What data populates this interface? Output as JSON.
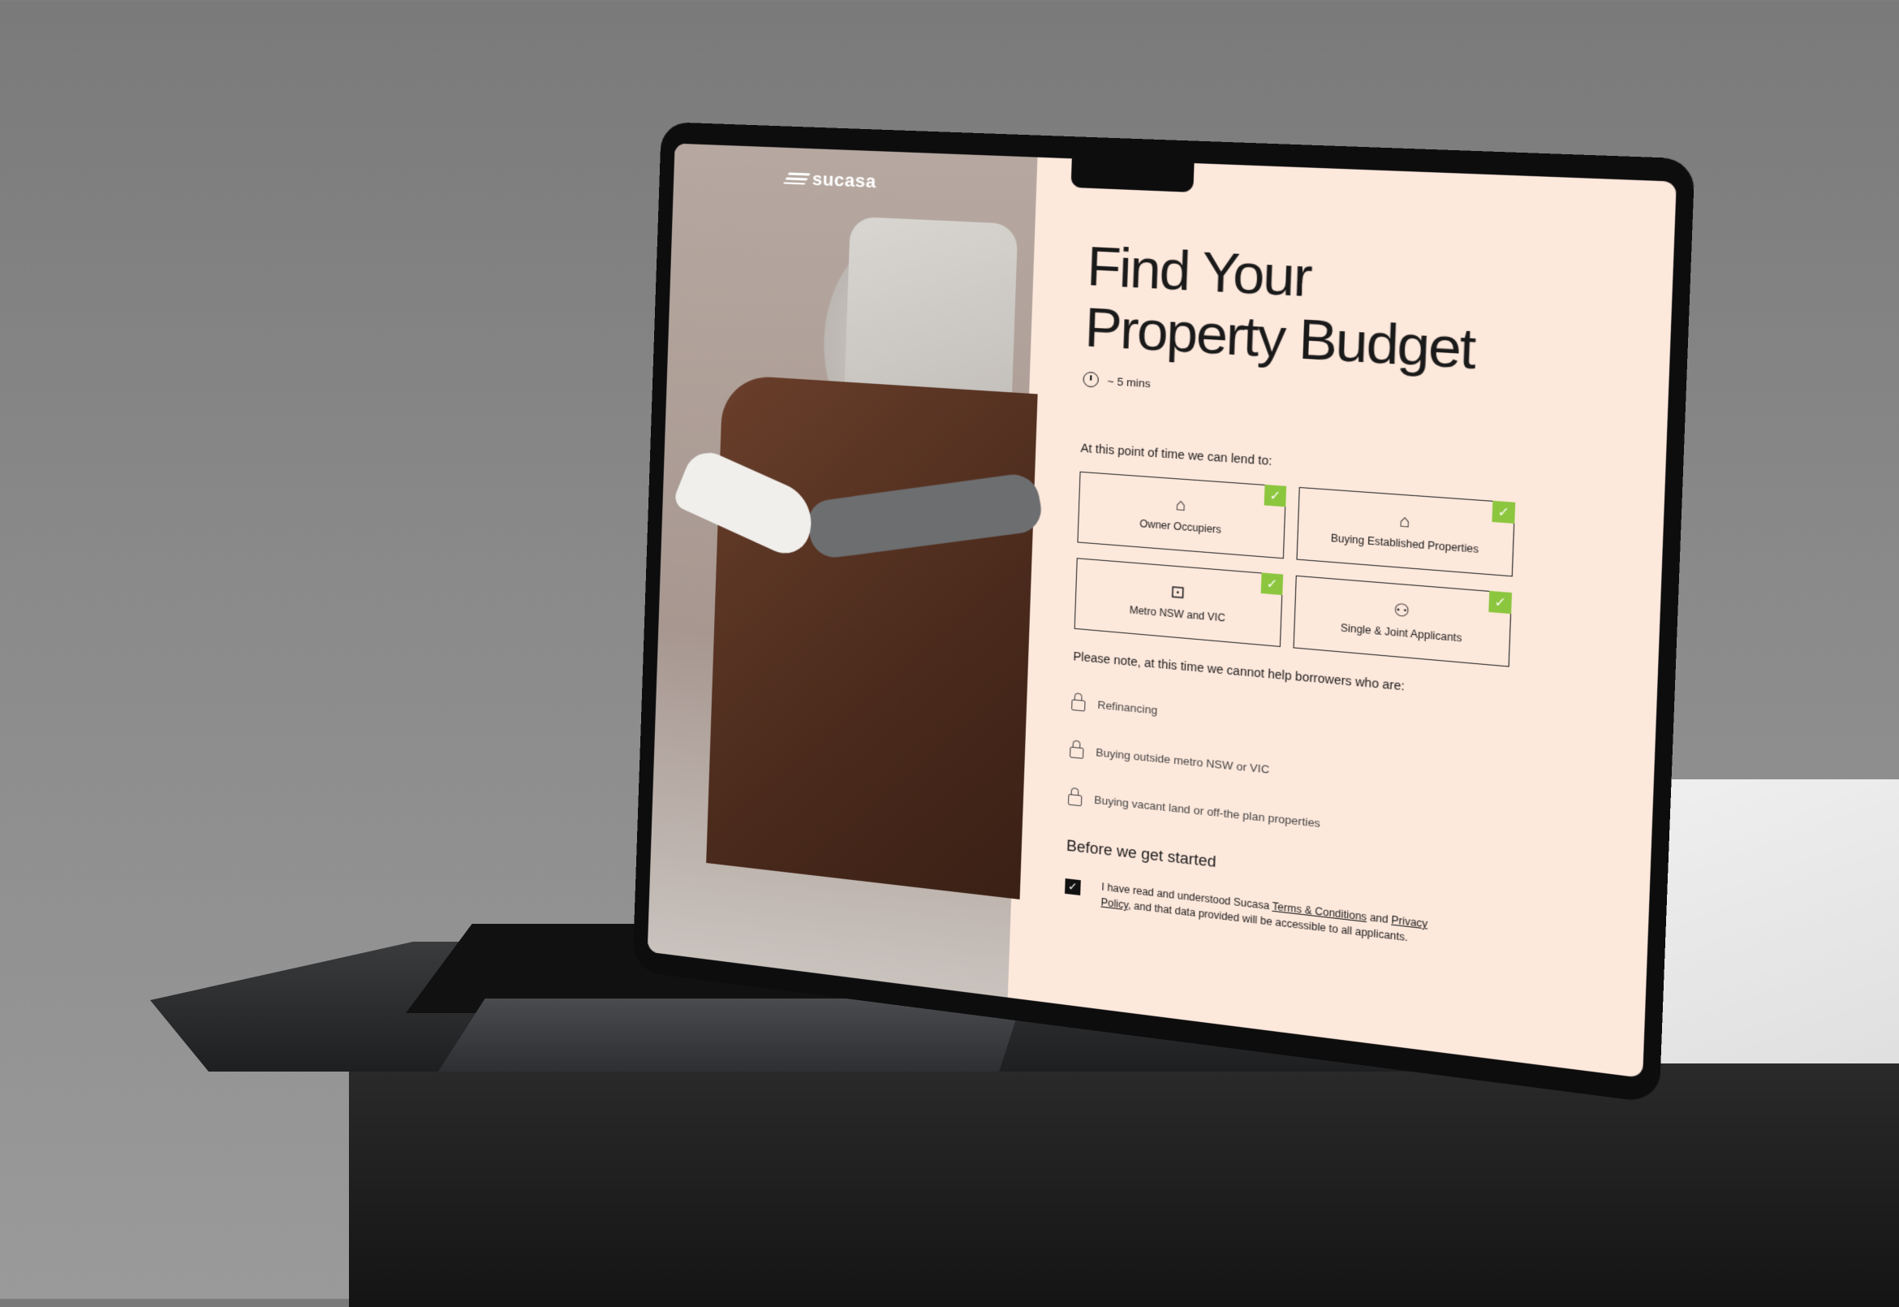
{
  "brand": {
    "logo_text": "sucasa"
  },
  "page": {
    "title": "Find Your Property Budget",
    "duration": "~ 5 mins"
  },
  "eligible": {
    "label": "At this point of time we can lend to:",
    "options": [
      {
        "label": "Owner Occupiers",
        "icon": "person-home-icon",
        "selected": true
      },
      {
        "label": "Buying Established Properties",
        "icon": "house-icon",
        "selected": true
      },
      {
        "label": "Metro NSW and VIC",
        "icon": "tram-icon",
        "selected": true
      },
      {
        "label": "Single & Joint Applicants",
        "icon": "people-icon",
        "selected": true
      }
    ]
  },
  "ineligible": {
    "label": "Please note, at this time we cannot help borrowers who are:",
    "items": [
      "Refinancing",
      "Buying outside metro NSW or VIC",
      "Buying vacant land or off-the plan properties"
    ]
  },
  "consent": {
    "heading": "Before we get started",
    "prefix": "I have read and understood Sucasa ",
    "terms_link": "Terms & Conditions",
    "middle": " and ",
    "privacy_link": "Privacy Policy",
    "suffix": ", and that data provided will be accessible to all applicants.",
    "checked": true
  },
  "colors": {
    "panel_bg": "#fde8dc",
    "check": "#8cc63f"
  }
}
